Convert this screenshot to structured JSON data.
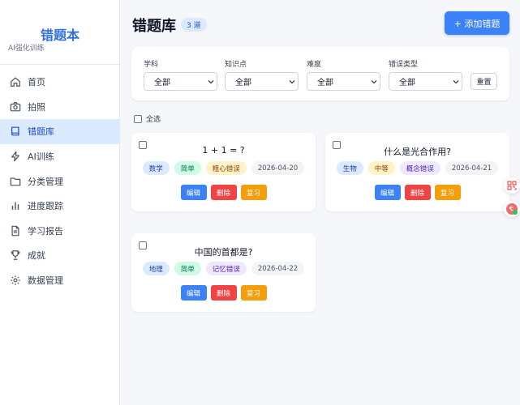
{
  "sidebar": {
    "brand_title": "错题本",
    "brand_subtitle": "AI强化训练",
    "items": [
      {
        "label": "首页",
        "icon": "home-icon"
      },
      {
        "label": "拍照",
        "icon": "camera-icon"
      },
      {
        "label": "错题库",
        "icon": "book-icon",
        "active": true
      },
      {
        "label": "AI训练",
        "icon": "lightning-icon"
      },
      {
        "label": "分类管理",
        "icon": "folder-icon"
      },
      {
        "label": "进度跟踪",
        "icon": "bar-chart-icon"
      },
      {
        "label": "学习报告",
        "icon": "document-icon"
      },
      {
        "label": "成就",
        "icon": "trophy-icon"
      },
      {
        "label": "数据管理",
        "icon": "gear-icon"
      }
    ]
  },
  "header": {
    "title": "错题库",
    "count_badge": "3 道",
    "add_button": "+ 添加错题"
  },
  "filters": {
    "subject": {
      "label": "学科",
      "value": "全部"
    },
    "knowledge": {
      "label": "知识点",
      "value": "全部"
    },
    "difficulty": {
      "label": "难度",
      "value": "全部"
    },
    "error_type": {
      "label": "错误类型",
      "value": "全部"
    },
    "reset_button": "重置"
  },
  "select_all_label": "全选",
  "cards": [
    {
      "title": "1 + 1 = ?",
      "subject": "数学",
      "difficulty": "简单",
      "error_type": "粗心错误",
      "date": "2026-04-20",
      "edit": "编辑",
      "delete": "删除",
      "review": "复习"
    },
    {
      "title": "什么是光合作用?",
      "subject": "生物",
      "difficulty": "中等",
      "error_type": "概念错误",
      "date": "2026-04-21",
      "edit": "编辑",
      "delete": "删除",
      "review": "复习"
    },
    {
      "title": "中国的首都是?",
      "subject": "地理",
      "difficulty": "简单",
      "error_type": "记忆错误",
      "date": "2026-04-22",
      "edit": "编辑",
      "delete": "删除",
      "review": "复习"
    }
  ],
  "colors": {
    "accent": "#3b82f6",
    "brand": "#2f6fde",
    "danger": "#ef4444",
    "warning": "#f59e0b"
  }
}
